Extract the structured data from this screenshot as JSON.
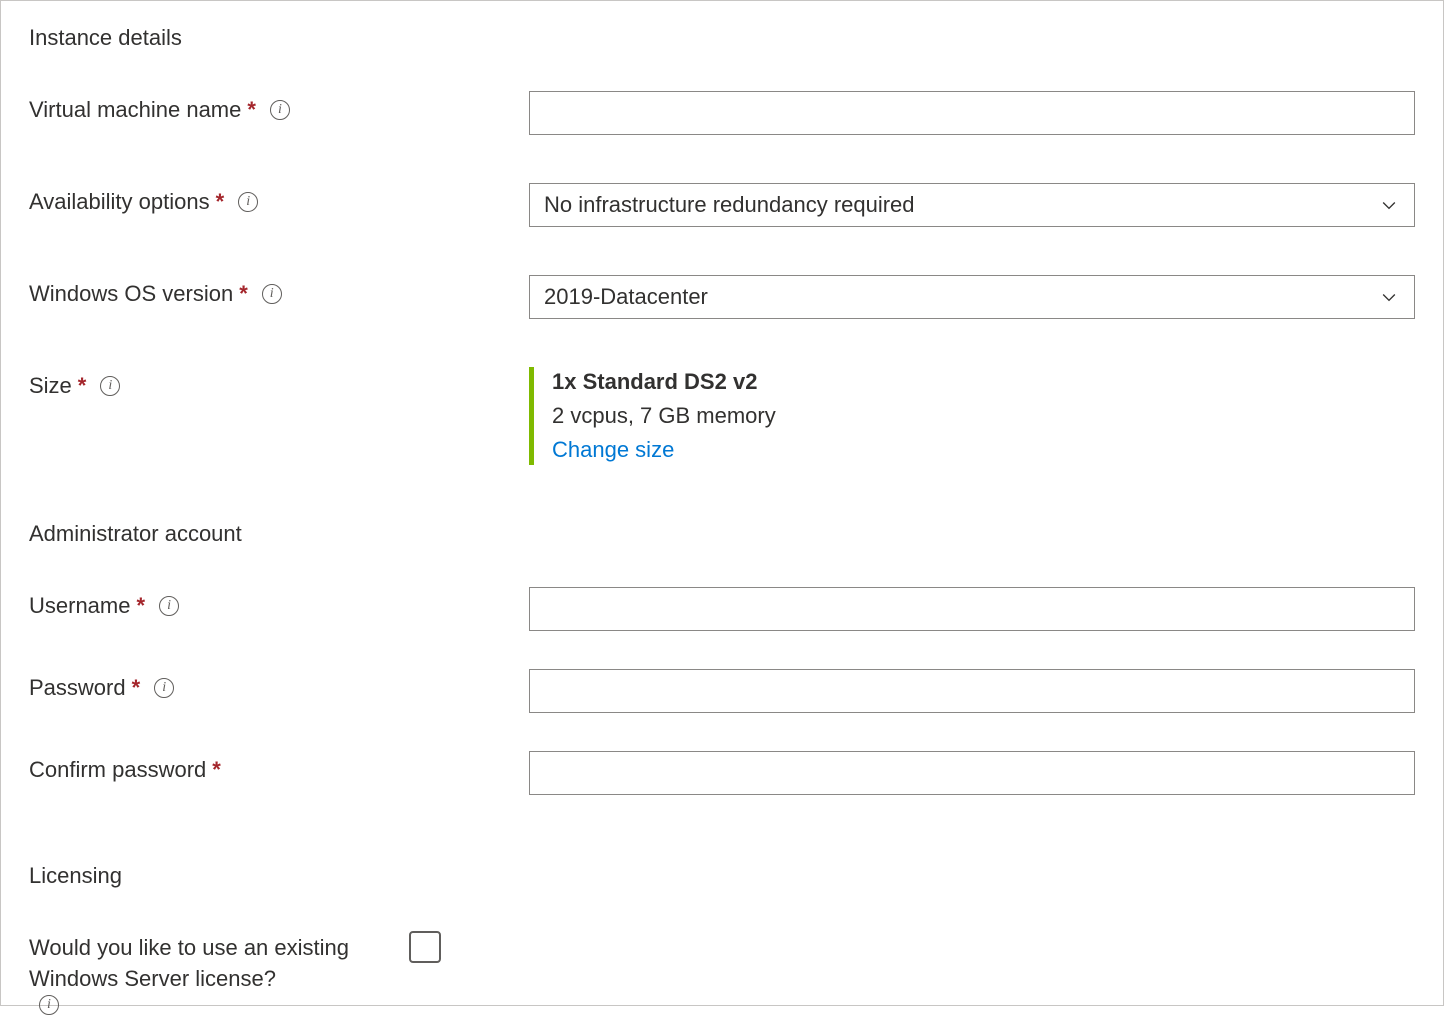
{
  "sections": {
    "instance": {
      "heading": "Instance details"
    },
    "admin": {
      "heading": "Administrator account"
    },
    "licensing": {
      "heading": "Licensing"
    }
  },
  "fields": {
    "vm_name": {
      "label": "Virtual machine name",
      "value": ""
    },
    "availability": {
      "label": "Availability options",
      "value": "No infrastructure redundancy required"
    },
    "os_version": {
      "label": "Windows OS version",
      "value": "2019-Datacenter"
    },
    "size": {
      "label": "Size",
      "title": "1x Standard DS2 v2",
      "sub": "2 vcpus, 7 GB memory",
      "change": "Change size"
    },
    "username": {
      "label": "Username",
      "value": ""
    },
    "password": {
      "label": "Password",
      "value": ""
    },
    "confirm_password": {
      "label": "Confirm password",
      "value": ""
    },
    "existing_license": {
      "label": "Would you like to use an existing Windows Server license?",
      "checked": false
    }
  }
}
